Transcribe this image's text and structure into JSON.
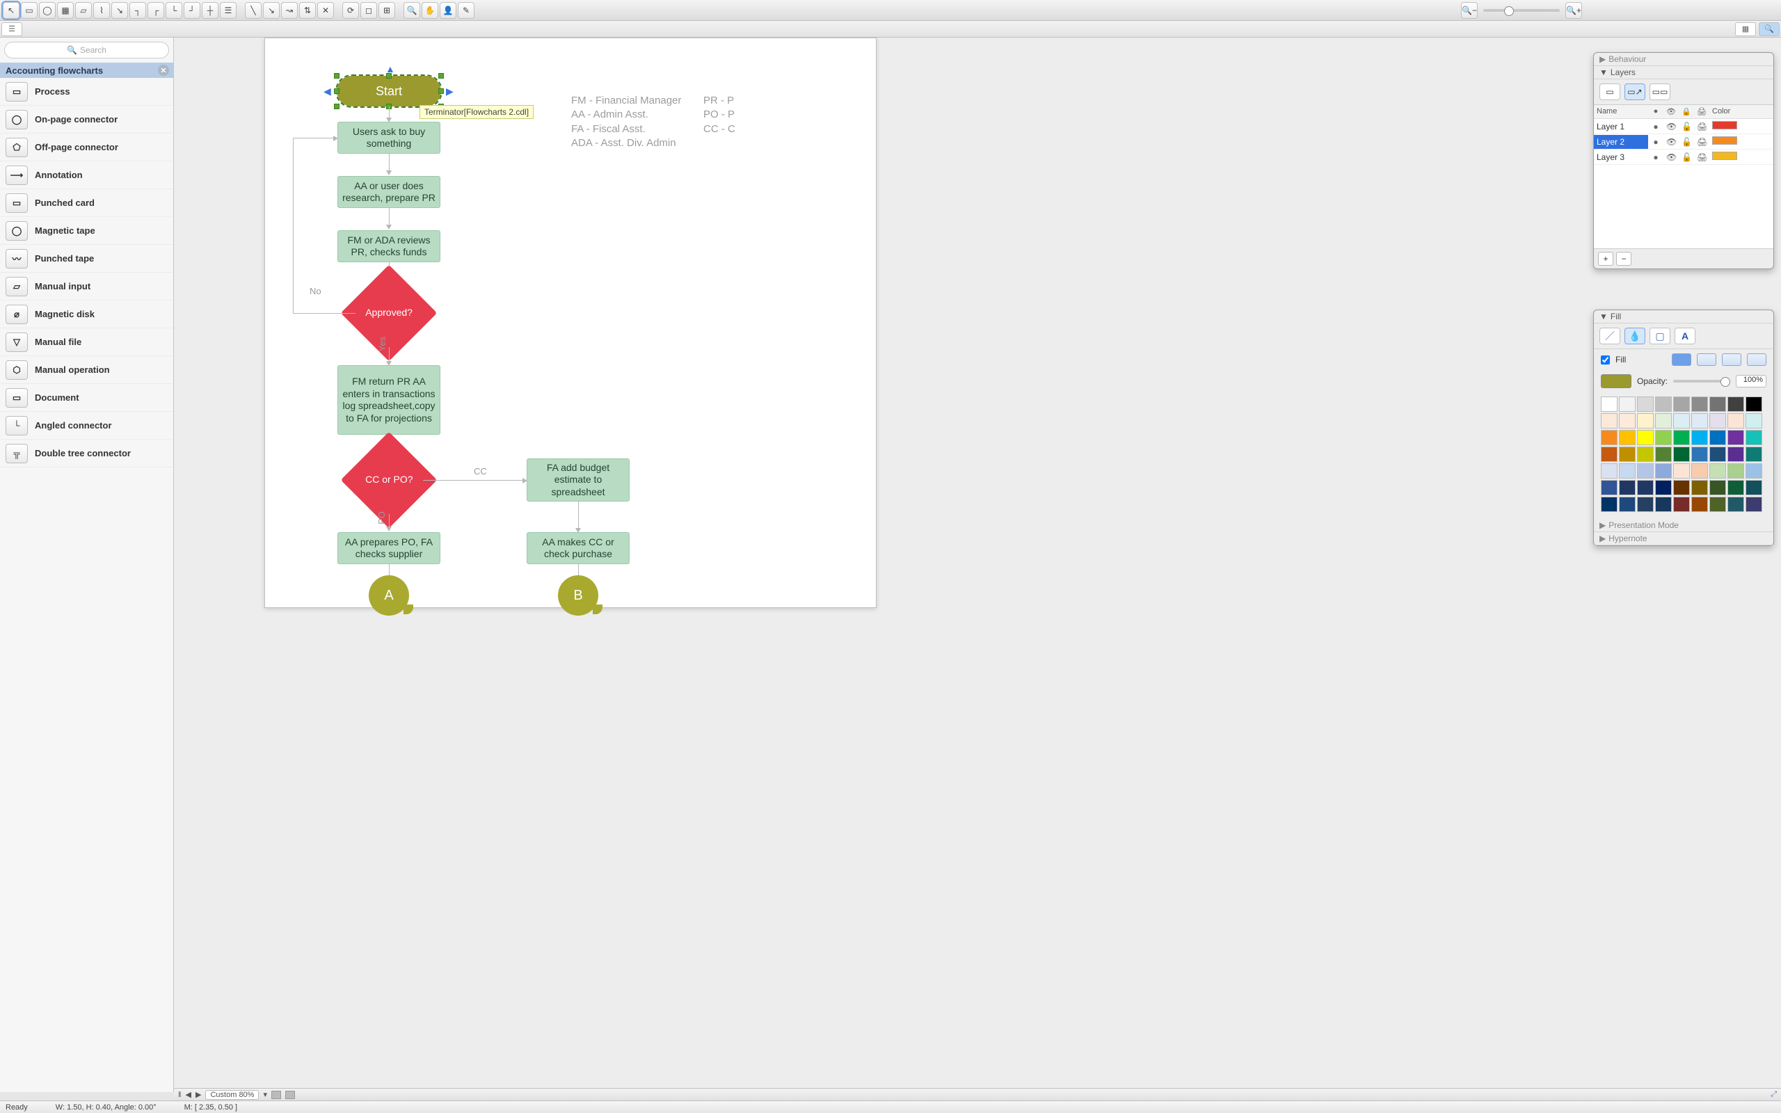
{
  "toolbar_groups": [
    [
      "↖",
      "▭",
      "◯",
      "▦",
      "▱",
      "⌇",
      "↘",
      "┐",
      "┌",
      "└",
      "┘",
      "┼",
      "☰"
    ],
    [
      "╲",
      "↘",
      "↝",
      "⇅",
      "✕"
    ],
    [
      "⟳",
      "◻",
      "⊞"
    ],
    [
      "🔍",
      "✋",
      "👤",
      "✎"
    ]
  ],
  "zoom_icons": {
    "out": "🔍−",
    "in": "🔍+"
  },
  "lib_head": {
    "grid": "▦",
    "search": "🔍"
  },
  "search_placeholder": "Search",
  "library_title": "Accounting flowcharts",
  "library_items": [
    {
      "label": "Process",
      "glyph": "▭"
    },
    {
      "label": "On-page connector",
      "glyph": "◯"
    },
    {
      "label": "Off-page connector",
      "glyph": "⬠"
    },
    {
      "label": "Annotation",
      "glyph": "⟶"
    },
    {
      "label": "Punched card",
      "glyph": "▭"
    },
    {
      "label": "Magnetic tape",
      "glyph": "◯"
    },
    {
      "label": "Punched tape",
      "glyph": "〰"
    },
    {
      "label": "Manual input",
      "glyph": "▱"
    },
    {
      "label": "Magnetic disk",
      "glyph": "⌀"
    },
    {
      "label": "Manual file",
      "glyph": "▽"
    },
    {
      "label": "Manual operation",
      "glyph": "⬡"
    },
    {
      "label": "Document",
      "glyph": "▭"
    },
    {
      "label": "Angled connector",
      "glyph": "└"
    },
    {
      "label": "Double tree connector",
      "glyph": "╦"
    }
  ],
  "flow": {
    "start": "Start",
    "tooltip": "Terminator[Flowcharts 2.cdl]",
    "n1": "Users ask to buy something",
    "n2": "AA or user does research, prepare PR",
    "n3": "FM or ADA reviews PR, checks funds",
    "d1": "Approved?",
    "no": "No",
    "yes": "Yes",
    "n4": "FM return PR AA enters in transactions log spreadsheet,copy to FA for projections",
    "d2": "CC or PO?",
    "cc": "CC",
    "po": "PO",
    "n5": "FA add budget estimate to spreadsheet",
    "n6": "AA prepares PO, FA checks supplier",
    "n7": "AA makes CC or check purchase",
    "a": "A",
    "b": "B"
  },
  "legend": [
    "FM - Financial Manager",
    "AA - Admin Asst.",
    "FA - Fiscal Asst.",
    "ADA - Asst. Div. Admin"
  ],
  "legend_right": [
    "PR - P",
    "PO - P",
    "CC - C"
  ],
  "right": {
    "behaviour": "Behaviour",
    "layers": "Layers",
    "name": "Name",
    "color": "Color",
    "rows": [
      {
        "name": "Layer 1",
        "sel": false,
        "color": "#e53b2e"
      },
      {
        "name": "Layer 2",
        "sel": true,
        "color": "#f58b1f"
      },
      {
        "name": "Layer 3",
        "sel": false,
        "color": "#f2b81f"
      }
    ],
    "presentation": "Presentation Mode",
    "hypernote": "Hypernote"
  },
  "fill": {
    "title": "Fill",
    "chk_label": "Fill",
    "opacity_label": "Opacity:",
    "opacity_value": "100%",
    "palette": [
      "#ffffff",
      "#f2f2f2",
      "#d9d9d9",
      "#bfbfbf",
      "#a6a6a6",
      "#8c8c8c",
      "#737373",
      "#404040",
      "#000000",
      "#fde9d9",
      "#fdeada",
      "#fff2cc",
      "#e2efda",
      "#daeef3",
      "#deebf7",
      "#e4dfec",
      "#fce4d6",
      "#d0f0f0",
      "#f58b1f",
      "#ffc000",
      "#ffff00",
      "#92d050",
      "#00b050",
      "#00b0f0",
      "#0070c0",
      "#7030a0",
      "#16c1b7",
      "#c55a11",
      "#bf8f00",
      "#c6c600",
      "#548235",
      "#006633",
      "#2e75b6",
      "#1f4e79",
      "#5b2e91",
      "#0e7c74",
      "#d9e1f2",
      "#c6d9f0",
      "#b4c6e7",
      "#8ea9db",
      "#fbe4d5",
      "#f8cbad",
      "#c5e0b3",
      "#a9d08e",
      "#9bc2e6",
      "#305496",
      "#203764",
      "#1f3864",
      "#002060",
      "#663300",
      "#7f6000",
      "#375623",
      "#0e5e3a",
      "#134f5c",
      "#003366",
      "#1f497d",
      "#254061",
      "#17375d",
      "#772c2a",
      "#984806",
      "#4f6228",
      "#215967",
      "#3c3c6e"
    ]
  },
  "bottom": {
    "zoom_label": "Custom 80%"
  },
  "status": {
    "ready": "Ready",
    "size": "W: 1.50,  H: 0.40,  Angle: 0.00°",
    "mouse": "M: [ 2.35, 0.50 ]"
  }
}
